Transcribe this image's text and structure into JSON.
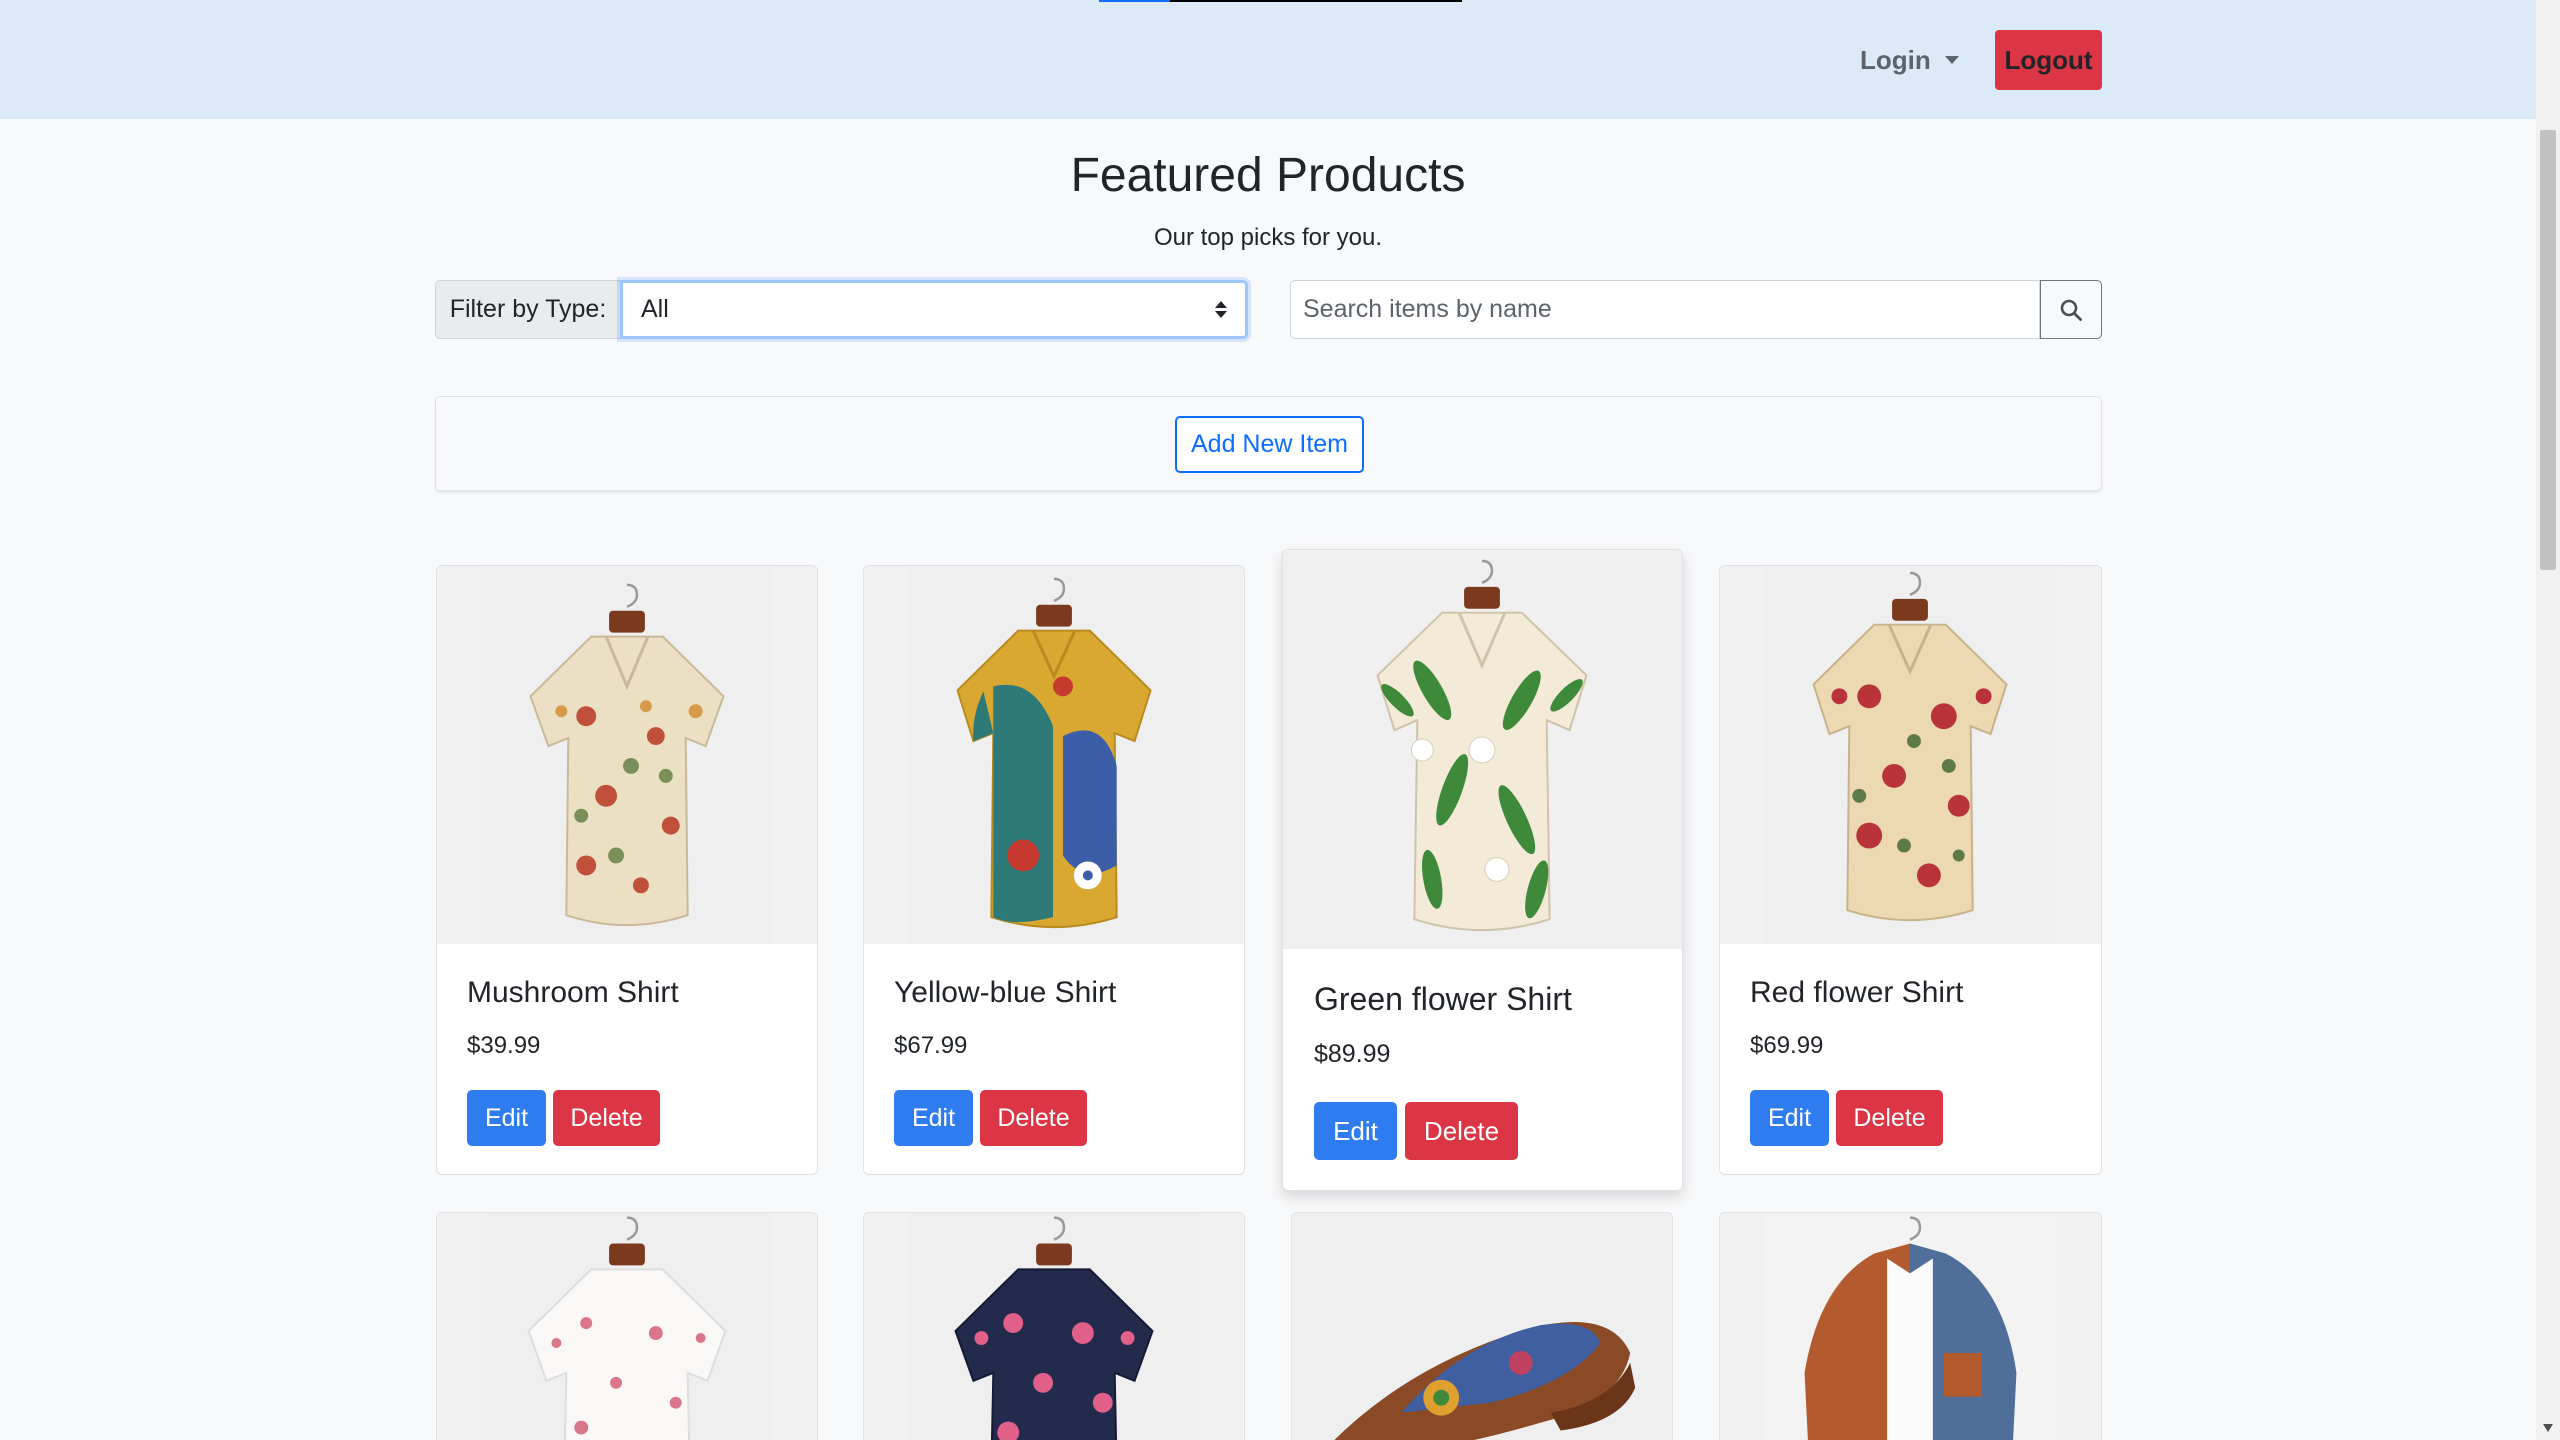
{
  "navbar": {
    "login_label": "Login",
    "logout_label": "Logout"
  },
  "header": {
    "title": "Featured Products",
    "subtitle": "Our top picks for you."
  },
  "filter": {
    "label": "Filter by Type:",
    "selected": "All"
  },
  "search": {
    "placeholder": "Search items by name"
  },
  "actions": {
    "add_new_label": "Add New Item",
    "edit_label": "Edit",
    "delete_label": "Delete"
  },
  "products": [
    {
      "name": "Mushroom Shirt",
      "price": "$39.99",
      "image": "mushroom-print-shirt"
    },
    {
      "name": "Yellow-blue Shirt",
      "price": "$67.99",
      "image": "yellow-blue-abstract-shirt"
    },
    {
      "name": "Green flower Shirt",
      "price": "$89.99",
      "image": "green-leaf-floral-shirt"
    },
    {
      "name": "Red flower Shirt",
      "price": "$69.99",
      "image": "red-floral-shirt"
    }
  ],
  "products_row2": [
    {
      "image": "pink-blossom-white-shirt"
    },
    {
      "image": "navy-floral-shirt"
    },
    {
      "image": "floral-leather-sandal"
    },
    {
      "image": "orange-denim-colorblock-shirt"
    }
  ],
  "colors": {
    "navbar_bg": "#dce9f7",
    "primary": "#0d6efd",
    "danger": "#dc3545",
    "page_bg": "#f8f9fa"
  }
}
